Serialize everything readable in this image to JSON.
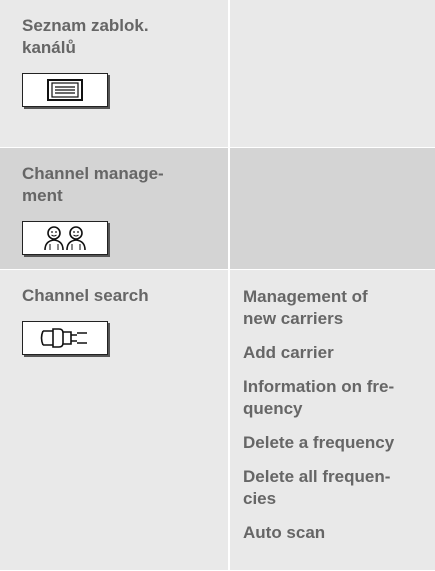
{
  "rows": [
    {
      "title": "Seznam zablok.\nkanálů",
      "icon": "channel-list-icon"
    },
    {
      "title": "Channel manage-\nment",
      "icon": "people-icon"
    },
    {
      "title": "Channel search",
      "icon": "antenna-plug-icon",
      "submenu": [
        "Management of\nnew carriers",
        "Add carrier",
        "Information on fre-\nquency",
        "Delete a frequency",
        "Delete all frequen-\ncies",
        "Auto scan"
      ]
    }
  ],
  "colors": {
    "cell_light": "#e9e9e9",
    "cell_dark": "#d4d4d4",
    "text": "#666666"
  }
}
